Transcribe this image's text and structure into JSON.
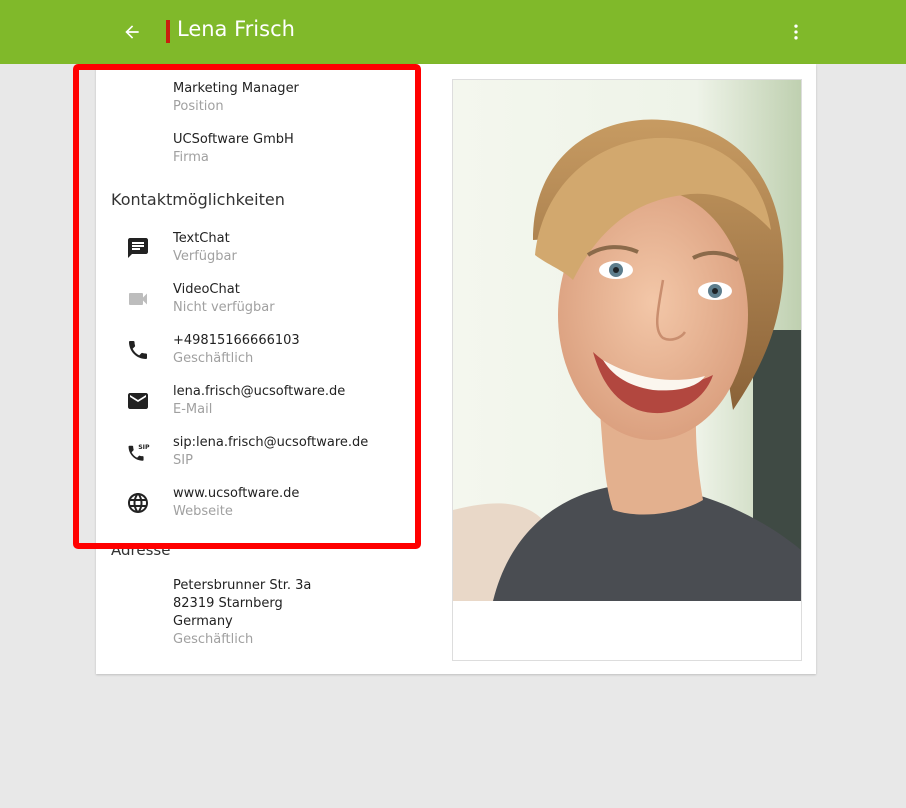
{
  "header": {
    "title": "Lena Frisch",
    "bar_color": "#80b92a",
    "accent_color": "#c81e0e",
    "back_icon": "arrow-back-icon",
    "menu_icon": "more-vert-icon"
  },
  "work": [
    {
      "primary": "Marketing Manager",
      "secondary": "Position"
    },
    {
      "primary": "UCSoftware GmbH",
      "secondary": "Firma"
    }
  ],
  "contact": {
    "heading": "Kontaktmöglichkeiten",
    "items": [
      {
        "icon": "chat-icon",
        "primary": "TextChat",
        "secondary": "Verfügbar"
      },
      {
        "icon": "videocam-icon",
        "primary": "VideoChat",
        "secondary": "Nicht verfügbar"
      },
      {
        "icon": "phone-icon",
        "primary": "+49815166666103",
        "secondary": "Geschäftlich"
      },
      {
        "icon": "email-icon",
        "primary": "lena.frisch@ucsoftware.de",
        "secondary": "E-Mail"
      },
      {
        "icon": "sip-phone-icon",
        "primary": "sip:lena.frisch@ucsoftware.de",
        "secondary": "SIP",
        "icon_text": "SIP"
      },
      {
        "icon": "globe-icon",
        "primary": "www.ucsoftware.de",
        "secondary": "Webseite"
      }
    ]
  },
  "address": {
    "heading": "Adresse",
    "street": "Petersbrunner Str. 3a",
    "city": "82319 Starnberg",
    "country": "Germany",
    "type": "Geschäftlich"
  },
  "highlight_color": "#ff0000"
}
